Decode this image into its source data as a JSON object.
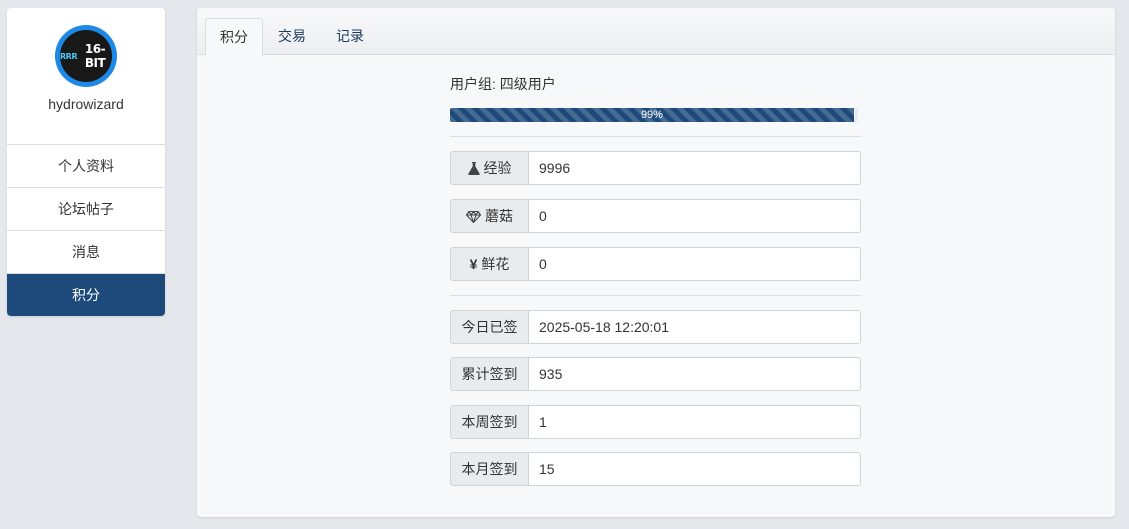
{
  "profile": {
    "avatar_text": "16-BIT",
    "avatar_prefix": "RRR",
    "username": "hydrowizard"
  },
  "sidebar": {
    "items": [
      {
        "label": "个人资料"
      },
      {
        "label": "论坛帖子"
      },
      {
        "label": "消息"
      },
      {
        "label": "积分",
        "active": true
      }
    ]
  },
  "tabs": [
    {
      "label": "积分",
      "active": true
    },
    {
      "label": "交易"
    },
    {
      "label": "记录"
    }
  ],
  "user_group": "用户组: 四级用户",
  "progress": {
    "percent": 99,
    "label": "99%"
  },
  "stats": [
    {
      "label": "经验",
      "icon": "flask-icon",
      "value": "9996"
    },
    {
      "label": "蘑菇",
      "icon": "diamond-icon",
      "value": "0"
    },
    {
      "label": "鲜花",
      "icon": "yen-icon",
      "value": "0"
    }
  ],
  "checkin": [
    {
      "label": "今日已签",
      "value": "2025-05-18 12:20:01"
    },
    {
      "label": "累计签到",
      "value": "935"
    },
    {
      "label": "本周签到",
      "value": "1"
    },
    {
      "label": "本月签到",
      "value": "15"
    }
  ],
  "colors": {
    "accent": "#1d4a7a",
    "avatar_ring": "#1e88e5",
    "background": "#e4e7eb"
  }
}
